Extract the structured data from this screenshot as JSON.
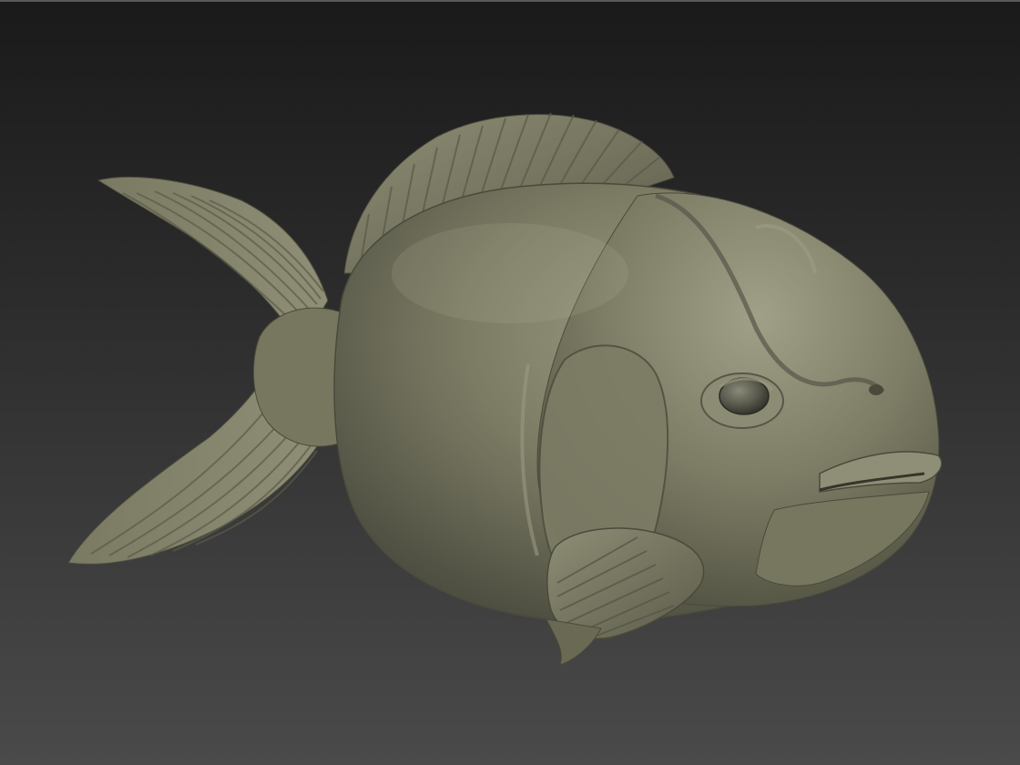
{
  "viewport": {
    "background_top": "#1a1a1a",
    "background_bottom": "#4a4a4a",
    "model_name": "fish-sculpt",
    "material_color": "#6e6e58",
    "highlight_color": "#a3a38c",
    "shadow_color": "#3e3e30"
  }
}
